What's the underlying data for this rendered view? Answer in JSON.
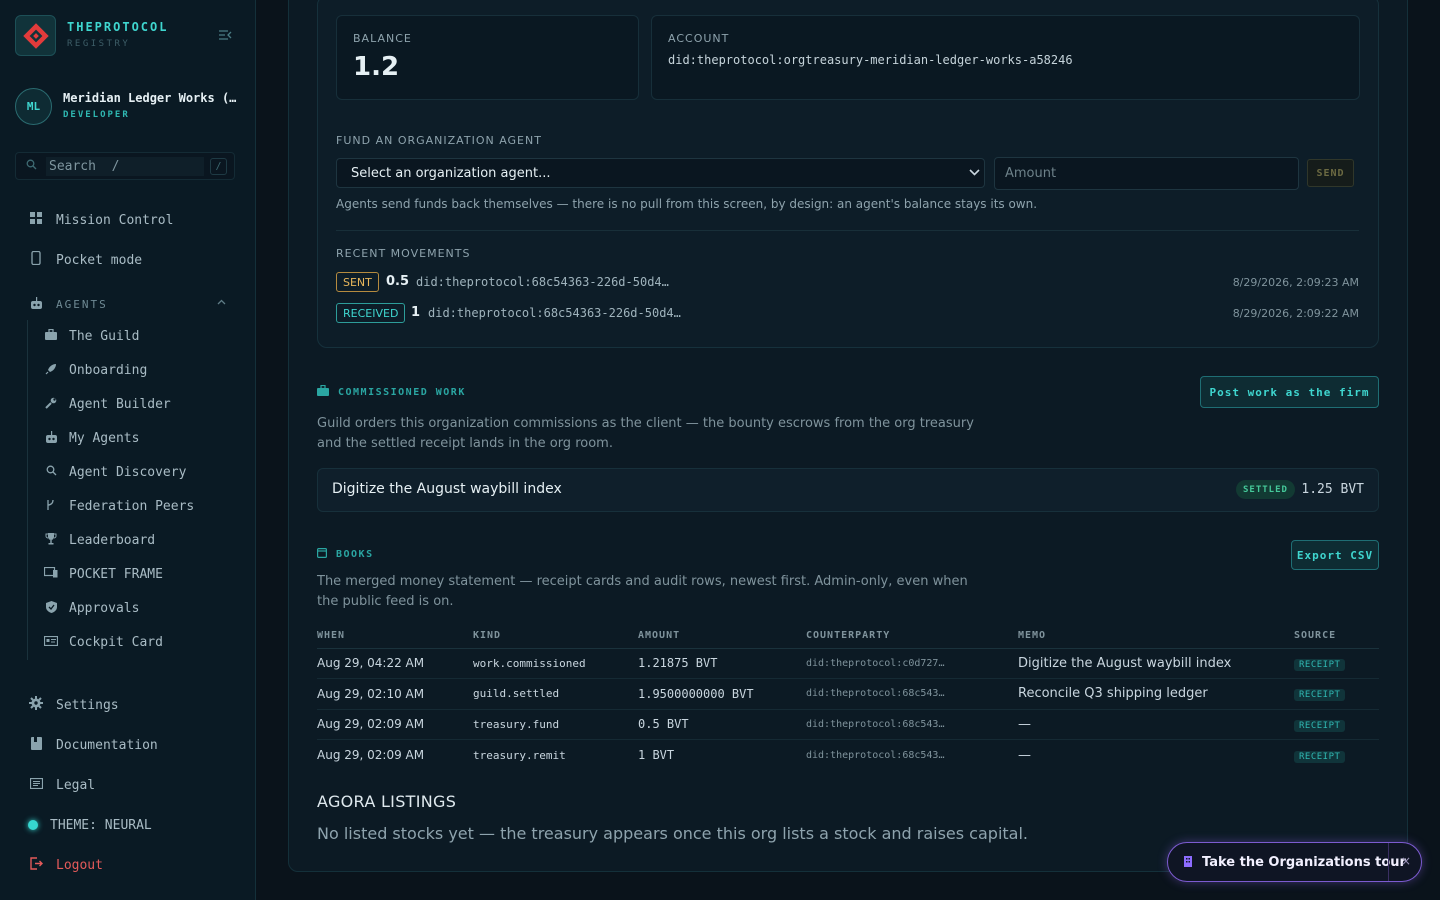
{
  "brand": {
    "name": "THEPROTOCOL",
    "sub": "REGISTRY"
  },
  "org": {
    "initials": "ML",
    "name": "Meridian Ledger Works (…",
    "role": "DEVELOPER"
  },
  "search": {
    "placeholder": "Search  /",
    "shortcut": "/"
  },
  "nav": {
    "mission_control": "Mission Control",
    "pocket_mode": "Pocket mode",
    "agents_header": "AGENTS",
    "agents_items": [
      "The Guild",
      "Onboarding",
      "Agent Builder",
      "My Agents",
      "Agent Discovery",
      "Federation Peers",
      "Leaderboard",
      "POCKET FRAME",
      "Approvals",
      "Cockpit Card"
    ],
    "settings": "Settings",
    "documentation": "Documentation",
    "legal": "Legal",
    "theme": "THEME: NEURAL",
    "logout": "Logout"
  },
  "treasury": {
    "balance_label": "BALANCE",
    "balance_value": "1.2",
    "account_label": "ACCOUNT",
    "account_value": "did:theprotocol:orgtreasury-meridian-ledger-works-a58246",
    "fund_label": "FUND AN ORGANIZATION AGENT",
    "select_value": "Select an organization agent...",
    "amount_placeholder": "Amount",
    "send_label": "SEND",
    "note": "Agents send funds back themselves — there is no pull from this screen, by design: an agent's balance stays its own.",
    "movements_label": "RECENT MOVEMENTS",
    "movements": [
      {
        "type": "SENT",
        "amount": "0.5",
        "did": "did:theprotocol:68c54363-226d-50d4…",
        "time": "8/29/2026, 2:09:23 AM"
      },
      {
        "type": "RECEIVED",
        "amount": "1",
        "did": "did:theprotocol:68c54363-226d-50d4…",
        "time": "8/29/2026, 2:09:22 AM"
      }
    ]
  },
  "commissioned": {
    "title": "COMMISSIONED WORK",
    "button": "Post work as the firm",
    "desc": "Guild orders this organization commissions as the client — the bounty escrows from the org treasury and the settled receipt lands in the org room.",
    "item_title": "Digitize the August waybill index",
    "item_status": "SETTLED",
    "item_amount": "1.25 BVT"
  },
  "books": {
    "title": "BOOKS",
    "button": "Export CSV",
    "desc": "The merged money statement — receipt cards and audit rows, newest first. Admin-only, even when the public feed is on.",
    "columns": [
      "WHEN",
      "KIND",
      "AMOUNT",
      "COUNTERPARTY",
      "MEMO",
      "SOURCE"
    ],
    "rows": [
      {
        "when": "Aug 29, 04:22 AM",
        "kind": "work.commissioned",
        "amount": "1.21875 BVT",
        "counterparty": "did:theprotocol:c0d727…",
        "memo": "Digitize the August waybill index",
        "source": "RECEIPT"
      },
      {
        "when": "Aug 29, 02:10 AM",
        "kind": "guild.settled",
        "amount": "1.9500000000 BVT",
        "counterparty": "did:theprotocol:68c543…",
        "memo": "Reconcile Q3 shipping ledger",
        "source": "RECEIPT"
      },
      {
        "when": "Aug 29, 02:09 AM",
        "kind": "treasury.fund",
        "amount": "0.5 BVT",
        "counterparty": "did:theprotocol:68c543…",
        "memo": "—",
        "source": "RECEIPT"
      },
      {
        "when": "Aug 29, 02:09 AM",
        "kind": "treasury.remit",
        "amount": "1 BVT",
        "counterparty": "did:theprotocol:68c543…",
        "memo": "—",
        "source": "RECEIPT"
      }
    ]
  },
  "agora": {
    "title": "AGORA LISTINGS",
    "desc": "No listed stocks yet — the treasury appears once this org lists a stock and raises capital."
  },
  "tour": {
    "label": "Take the Organizations tour",
    "close": "×"
  },
  "colors": {
    "accent": "#3fd6cf",
    "sent": "#e7b65b",
    "logout": "#e45a5a",
    "tour": "#7c5bd0"
  }
}
